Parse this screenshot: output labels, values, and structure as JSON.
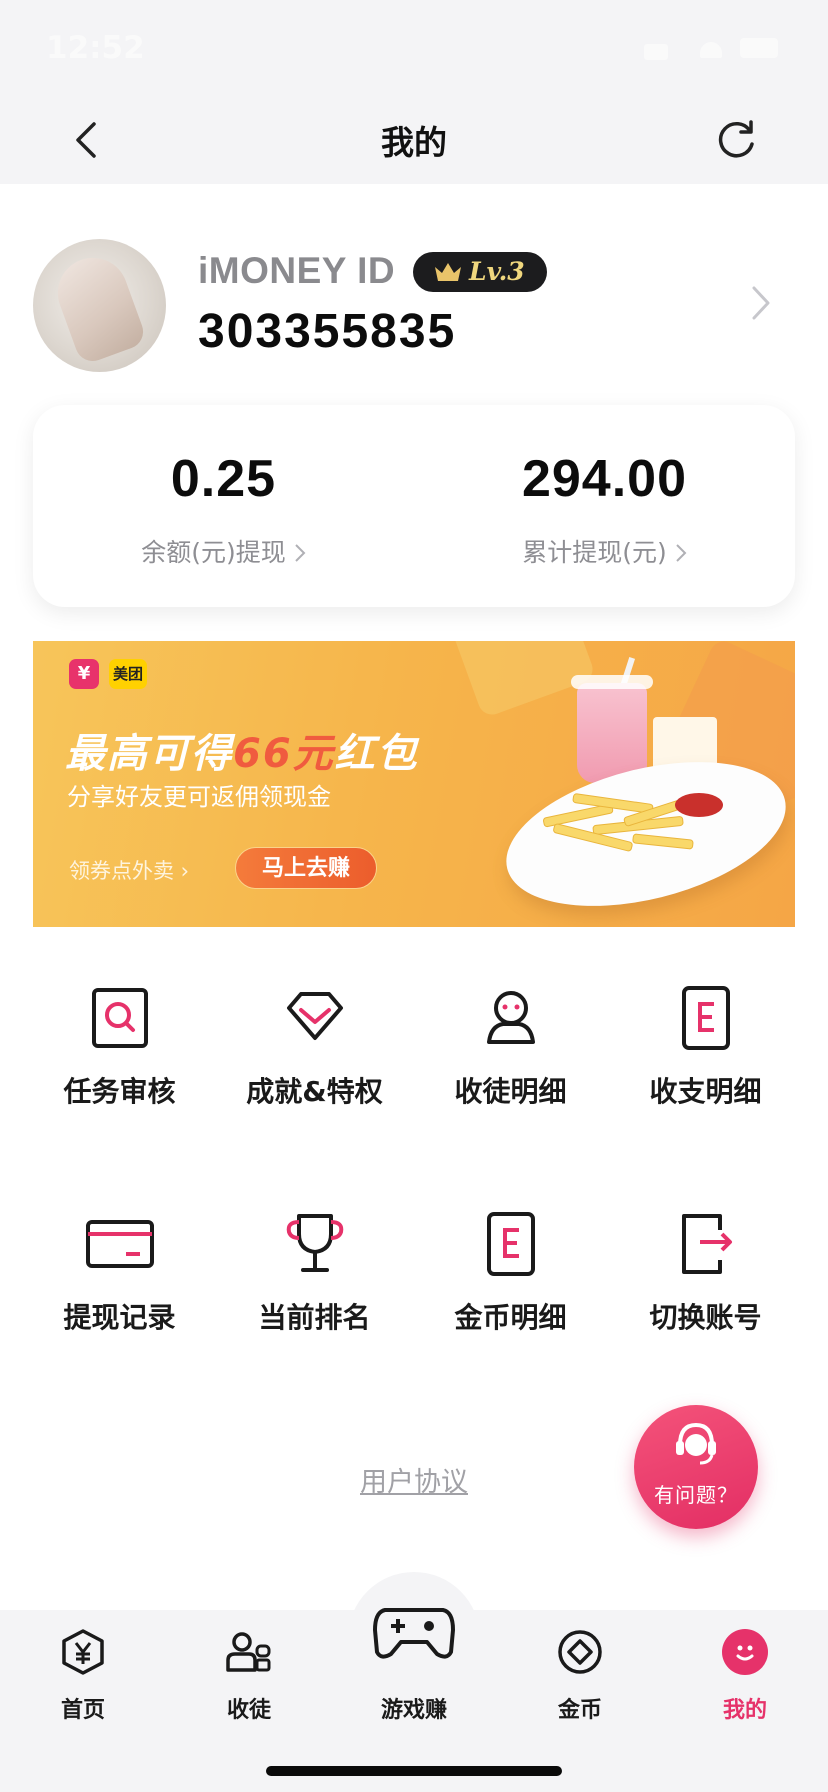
{
  "status_bar": {
    "time": "12:52"
  },
  "nav": {
    "title": "我的"
  },
  "profile": {
    "id_label": "iMONEY ID",
    "level": "Lv.3",
    "id_value": "303355835"
  },
  "balance": {
    "left": {
      "value": "0.25",
      "label": "余额(元)提现"
    },
    "right": {
      "value": "294.00",
      "label": "累计提现(元)"
    }
  },
  "banner": {
    "logo_left": "¥",
    "logo_right": "美团",
    "headline_prefix": "最高可得",
    "headline_highlight": "66元",
    "headline_suffix": "红包",
    "subtitle": "分享好友更可返佣领现金",
    "coupon_text": "领券点外卖 ›",
    "button_label": "马上去赚"
  },
  "menu": [
    {
      "label": "任务审核",
      "icon": "task-review-icon"
    },
    {
      "label": "成就&特权",
      "icon": "diamond-icon"
    },
    {
      "label": "收徒明细",
      "icon": "apprentice-icon"
    },
    {
      "label": "收支明细",
      "icon": "ledger-icon"
    },
    {
      "label": "提现记录",
      "icon": "card-icon"
    },
    {
      "label": "当前排名",
      "icon": "trophy-icon"
    },
    {
      "label": "金币明细",
      "icon": "coin-ledger-icon"
    },
    {
      "label": "切换账号",
      "icon": "switch-account-icon"
    }
  ],
  "footer": {
    "agreement": "用户协议"
  },
  "help_button": {
    "label": "有问题？"
  },
  "tabs": [
    {
      "label": "首页",
      "icon": "yen-home-icon"
    },
    {
      "label": "收徒",
      "icon": "apprentice-tab-icon"
    },
    {
      "label": "游戏赚",
      "icon": "gamepad-icon"
    },
    {
      "label": "金币",
      "icon": "coin-icon"
    },
    {
      "label": "我的",
      "icon": "me-icon"
    }
  ],
  "colors": {
    "accent": "#e6326a",
    "banner": "#f6b54b",
    "text": "#111111",
    "muted": "#8e8e93"
  }
}
